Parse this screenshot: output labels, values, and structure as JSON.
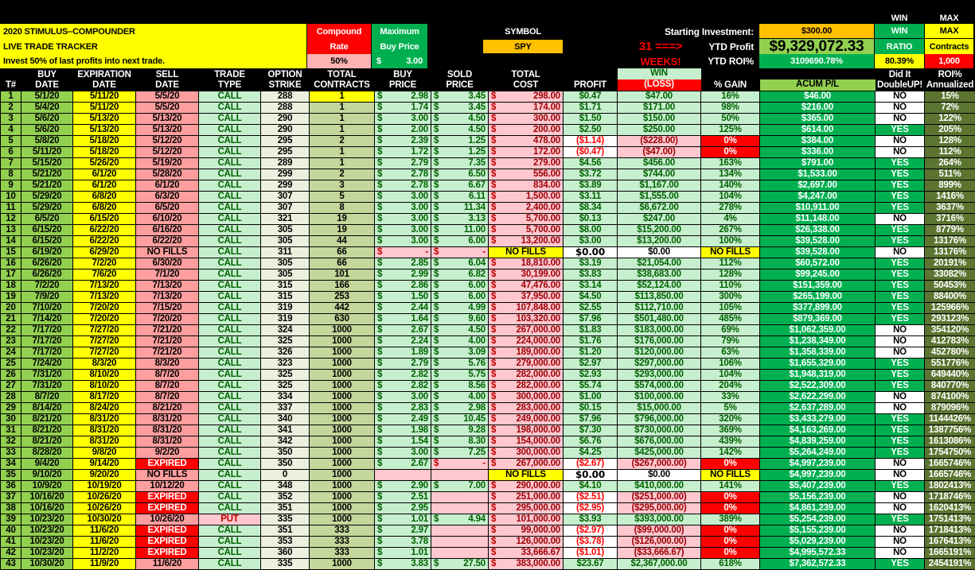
{
  "header": {
    "title1": "2020 STIMULUS–COMPOUNDER",
    "title2": "LIVE TRADE TRACKER",
    "note": "Invest 50% of last profits into next trade.",
    "compound_label1": "Compound",
    "compound_label2": "Rate",
    "compound_value": "50%",
    "maxbuy_label1": "Maximum",
    "maxbuy_label2": "Buy Price",
    "maxbuy_currency": "$",
    "maxbuy_value": "3.00",
    "symbol_label": "SYMBOL",
    "symbol_value": "SPY",
    "weeks_count": "31 ===>",
    "weeks_label": "WEEKS!",
    "starting_label": "Starting Investment:",
    "starting_value": "$300.00",
    "ytd_profit_label": "YTD Profit",
    "ytd_profit_value": "$9,329,072.33",
    "ytd_roi_label": "YTD ROI%",
    "ytd_roi_value": "3109690.78%",
    "win_top": "WIN",
    "win_label1": "WIN",
    "win_label2": "RATIO",
    "win_value": "80.39%",
    "max_top": "MAX",
    "max_label1": "MAX",
    "max_label2": "Contracts",
    "max_value": "1,000"
  },
  "columns": [
    "T#",
    "BUY\nDATE",
    "EXPIRATION\nDATE",
    "SELL\nDATE",
    "TRADE\nTYPE",
    "OPTION\nSTRIKE",
    "TOTAL\nCONTRACTS",
    "BUY\nPRICE",
    "SOLD\nPRICE",
    "TOTAL\nCOST",
    "PROFIT",
    "WIN",
    "(LOSS)",
    "% GAIN",
    "ACUM P/L",
    "Did It\nDoubleUP!",
    "ROI%\nAnnualized"
  ],
  "currency": "$",
  "rows": [
    [
      "1",
      "5/1/20",
      "5/11/20",
      "5/5/20",
      "CALL",
      "288",
      "1",
      "2.98",
      "3.45",
      "298.00",
      "$0.47",
      "$47.00",
      "16%",
      "$46.00",
      "NO",
      "15%"
    ],
    [
      "2",
      "5/4/20",
      "5/11/20",
      "5/5/20",
      "CALL",
      "288",
      "1",
      "1.74",
      "3.45",
      "174.00",
      "$1.71",
      "$171.00",
      "98%",
      "$216.00",
      "NO",
      "72%"
    ],
    [
      "3",
      "5/6/20",
      "5/13/20",
      "5/13/20",
      "CALL",
      "290",
      "1",
      "3.00",
      "4.50",
      "300.00",
      "$1.50",
      "$150.00",
      "50%",
      "$365.00",
      "NO",
      "122%"
    ],
    [
      "4",
      "5/6/20",
      "5/13/20",
      "5/13/20",
      "CALL",
      "290",
      "1",
      "2.00",
      "4.50",
      "200.00",
      "$2.50",
      "$250.00",
      "125%",
      "$614.00",
      "YES",
      "205%"
    ],
    [
      "5",
      "5/8/20",
      "5/18/20",
      "5/12/20",
      "CALL",
      "295",
      "2",
      "2.39",
      "1.25",
      "478.00",
      "($1.14)",
      "($228.00)",
      "0%",
      "$384.00",
      "NO",
      "128%"
    ],
    [
      "6",
      "5/11/20",
      "5/18/20",
      "5/12/20",
      "CALL",
      "295",
      "1",
      "1.72",
      "1.25",
      "172.00",
      "($0.47)",
      "($47.00)",
      "0%",
      "$336.00",
      "NO",
      "112%"
    ],
    [
      "7",
      "5/15/20",
      "5/26/20",
      "5/19/20",
      "CALL",
      "289",
      "1",
      "2.79",
      "7.35",
      "279.00",
      "$4.56",
      "$456.00",
      "163%",
      "$791.00",
      "YES",
      "264%"
    ],
    [
      "8",
      "5/21/20",
      "6/1/20",
      "5/28/20",
      "CALL",
      "299",
      "2",
      "2.78",
      "6.50",
      "556.00",
      "$3.72",
      "$744.00",
      "134%",
      "$1,533.00",
      "YES",
      "511%"
    ],
    [
      "9",
      "5/21/20",
      "6/1/20",
      "6/1/20",
      "CALL",
      "299",
      "3",
      "2.78",
      "6.67",
      "834.00",
      "$3.89",
      "$1,167.00",
      "140%",
      "$2,697.00",
      "YES",
      "899%"
    ],
    [
      "10",
      "5/29/20",
      "6/8/20",
      "6/3/20",
      "CALL",
      "307",
      "5",
      "3.00",
      "6.11",
      "1,500.00",
      "$3.11",
      "$1,555.00",
      "104%",
      "$4,247.00",
      "YES",
      "1416%"
    ],
    [
      "11",
      "5/29/20",
      "6/8/20",
      "6/5/20",
      "CALL",
      "307",
      "8",
      "3.00",
      "11.34",
      "2,400.00",
      "$8.34",
      "$6,672.00",
      "278%",
      "$10,911.00",
      "YES",
      "3637%"
    ],
    [
      "12",
      "6/5/20",
      "6/15/20",
      "6/10/20",
      "CALL",
      "321",
      "19",
      "3.00",
      "3.13",
      "5,700.00",
      "$0.13",
      "$247.00",
      "4%",
      "$11,148.00",
      "NO",
      "3716%"
    ],
    [
      "13",
      "6/15/20",
      "6/22/20",
      "6/16/20",
      "CALL",
      "305",
      "19",
      "3.00",
      "11.00",
      "5,700.00",
      "$8.00",
      "$15,200.00",
      "267%",
      "$26,338.00",
      "YES",
      "8779%"
    ],
    [
      "14",
      "6/15/20",
      "6/22/20",
      "6/22/20",
      "CALL",
      "305",
      "44",
      "3.00",
      "6.00",
      "13,200.00",
      "$3.00",
      "$13,200.00",
      "100%",
      "$39,528.00",
      "YES",
      "13176%"
    ],
    [
      "15",
      "6/19/20",
      "6/29/20",
      "NO FILLS",
      "CALL",
      "311",
      "66",
      "-",
      "-",
      "NO FILLS",
      "$0.00",
      "$0.00",
      "NO FILLS",
      "$39,528.00",
      "NO",
      "13176%"
    ],
    [
      "16",
      "6/26/20",
      "7/2/20",
      "6/30/20",
      "CALL",
      "305",
      "66",
      "2.85",
      "6.04",
      "18,810.00",
      "$3.19",
      "$21,054.00",
      "112%",
      "$60,572.00",
      "YES",
      "20191%"
    ],
    [
      "17",
      "6/26/20",
      "7/6/20",
      "7/1/20",
      "CALL",
      "305",
      "101",
      "2.99",
      "6.82",
      "30,199.00",
      "$3.83",
      "$38,683.00",
      "128%",
      "$99,245.00",
      "YES",
      "33082%"
    ],
    [
      "18",
      "7/2/20",
      "7/13/20",
      "7/13/20",
      "CALL",
      "315",
      "166",
      "2.86",
      "6.00",
      "47,476.00",
      "$3.14",
      "$52,124.00",
      "110%",
      "$151,359.00",
      "YES",
      "50453%"
    ],
    [
      "19",
      "7/9/20",
      "7/13/20",
      "7/13/20",
      "CALL",
      "315",
      "253",
      "1.50",
      "6.00",
      "37,950.00",
      "$4.50",
      "$113,850.00",
      "300%",
      "$265,199.00",
      "YES",
      "88400%"
    ],
    [
      "20",
      "7/10/20",
      "7/20/20",
      "7/15/20",
      "CALL",
      "319",
      "442",
      "2.44",
      "4.99",
      "107,848.00",
      "$2.55",
      "$112,710.00",
      "105%",
      "$377,899.00",
      "YES",
      "125966%"
    ],
    [
      "21",
      "7/14/20",
      "7/20/20",
      "7/20/20",
      "CALL",
      "319",
      "630",
      "1.64",
      "9.60",
      "103,320.00",
      "$7.96",
      "$501,480.00",
      "485%",
      "$879,369.00",
      "YES",
      "293123%"
    ],
    [
      "22",
      "7/17/20",
      "7/27/20",
      "7/21/20",
      "CALL",
      "324",
      "1000",
      "2.67",
      "4.50",
      "267,000.00",
      "$1.83",
      "$183,000.00",
      "69%",
      "$1,062,359.00",
      "NO",
      "354120%"
    ],
    [
      "23",
      "7/17/20",
      "7/27/20",
      "7/21/20",
      "CALL",
      "325",
      "1000",
      "2.24",
      "4.00",
      "224,000.00",
      "$1.76",
      "$176,000.00",
      "79%",
      "$1,238,349.00",
      "NO",
      "412783%"
    ],
    [
      "24",
      "7/17/20",
      "7/27/20",
      "7/21/20",
      "CALL",
      "326",
      "1000",
      "1.89",
      "3.09",
      "189,000.00",
      "$1.20",
      "$120,000.00",
      "63%",
      "$1,358,339.00",
      "NO",
      "452780%"
    ],
    [
      "25",
      "7/24/20",
      "8/3/20",
      "8/3/20",
      "CALL",
      "323",
      "1000",
      "2.79",
      "5.76",
      "279,000.00",
      "$2.97",
      "$297,000.00",
      "106%",
      "$1,655,329.00",
      "YES",
      "551776%"
    ],
    [
      "26",
      "7/31/20",
      "8/10/20",
      "8/7/20",
      "CALL",
      "325",
      "1000",
      "2.82",
      "5.75",
      "282,000.00",
      "$2.93",
      "$293,000.00",
      "104%",
      "$1,948,319.00",
      "YES",
      "649440%"
    ],
    [
      "27",
      "7/31/20",
      "8/10/20",
      "8/7/20",
      "CALL",
      "325",
      "1000",
      "2.82",
      "8.56",
      "282,000.00",
      "$5.74",
      "$574,000.00",
      "204%",
      "$2,522,309.00",
      "YES",
      "840770%"
    ],
    [
      "28",
      "8/7/20",
      "8/17/20",
      "8/7/20",
      "CALL",
      "334",
      "1000",
      "3.00",
      "4.00",
      "300,000.00",
      "$1.00",
      "$100,000.00",
      "33%",
      "$2,622,299.00",
      "NO",
      "874100%"
    ],
    [
      "29",
      "8/14/20",
      "8/24/20",
      "8/21/20",
      "CALL",
      "337",
      "1000",
      "2.83",
      "2.98",
      "283,000.00",
      "$0.15",
      "$15,000.00",
      "5%",
      "$2,637,289.00",
      "NO",
      "879096%"
    ],
    [
      "30",
      "8/21/20",
      "8/31/20",
      "8/31/20",
      "CALL",
      "340",
      "1000",
      "2.49",
      "10.45",
      "249,000.00",
      "$7.96",
      "$796,000.00",
      "320%",
      "$3,433,279.00",
      "YES",
      "1144426%"
    ],
    [
      "31",
      "8/21/20",
      "8/31/20",
      "8/31/20",
      "CALL",
      "341",
      "1000",
      "1.98",
      "9.28",
      "198,000.00",
      "$7.30",
      "$730,000.00",
      "369%",
      "$4,163,269.00",
      "YES",
      "1387756%"
    ],
    [
      "32",
      "8/21/20",
      "8/31/20",
      "8/31/20",
      "CALL",
      "342",
      "1000",
      "1.54",
      "8.30",
      "154,000.00",
      "$6.76",
      "$676,000.00",
      "439%",
      "$4,839,259.00",
      "YES",
      "1613086%"
    ],
    [
      "33",
      "8/28/20",
      "9/8/20",
      "9/2/20",
      "CALL",
      "350",
      "1000",
      "3.00",
      "7.25",
      "300,000.00",
      "$4.25",
      "$425,000.00",
      "142%",
      "$5,264,249.00",
      "YES",
      "1754750%"
    ],
    [
      "34",
      "9/4/20",
      "9/14/20",
      "EXPIRED",
      "CALL",
      "350",
      "1000",
      "2.67",
      "-",
      "267,000.00",
      "($2.67)",
      "($267,000.00)",
      "0%",
      "$4,997,239.00",
      "NO",
      "1665746%"
    ],
    [
      "35",
      "9/10/20",
      "9/20/20",
      "NO FILLS",
      "CALL",
      "0",
      "1000",
      "",
      "",
      "NO FILLS",
      "$0.00",
      "$0.00",
      "NO FILLS",
      "$4,997,239.00",
      "NO",
      "1665746%"
    ],
    [
      "36",
      "10/9/20",
      "10/19/20",
      "10/12/20",
      "CALL",
      "348",
      "1000",
      "2.90",
      "7.00",
      "290,000.00",
      "$4.10",
      "$410,000.00",
      "141%",
      "$5,407,239.00",
      "YES",
      "1802413%"
    ],
    [
      "37",
      "10/16/20",
      "10/26/20",
      "EXPIRED",
      "CALL",
      "352",
      "1000",
      "2.51",
      "",
      "251,000.00",
      "($2.51)",
      "($251,000.00)",
      "0%",
      "$5,156,239.00",
      "NO",
      "1718746%"
    ],
    [
      "38",
      "10/16/20",
      "10/26/20",
      "EXPIRED",
      "CALL",
      "351",
      "1000",
      "2.95",
      "",
      "295,000.00",
      "($2.95)",
      "($295,000.00)",
      "0%",
      "$4,861,239.00",
      "NO",
      "1620413%"
    ],
    [
      "39",
      "10/23/20",
      "10/30/20",
      "10/26/20",
      "PUT",
      "335",
      "1000",
      "1.01",
      "4.94",
      "101,000.00",
      "$3.93",
      "$393,000.00",
      "389%",
      "$5,254,239.00",
      "YES",
      "1751413%"
    ],
    [
      "40",
      "10/23/20",
      "11/6/20",
      "EXPIRED",
      "CALL",
      "351",
      "333",
      "2.97",
      "",
      "99,000.00",
      "($2.97)",
      "($99,000.00)",
      "0%",
      "$5,155,239.00",
      "NO",
      "1718413%"
    ],
    [
      "41",
      "10/23/20",
      "11/6/20",
      "EXPIRED",
      "CALL",
      "353",
      "333",
      "3.78",
      "",
      "126,000.00",
      "($3.78)",
      "($126,000.00)",
      "0%",
      "$5,029,239.00",
      "NO",
      "1676413%"
    ],
    [
      "42",
      "10/23/20",
      "11/2/20",
      "EXPIRED",
      "CALL",
      "360",
      "333",
      "1.01",
      "",
      "33,666.67",
      "($1.01)",
      "($33,666.67)",
      "0%",
      "$4,995,572.33",
      "NO",
      "1665191%"
    ],
    [
      "43",
      "10/30/20",
      "11/9/20",
      "11/6/20",
      "CALL",
      "335",
      "1000",
      "3.83",
      "27.50",
      "383,000.00",
      "$23.67",
      "$2,367,000.00",
      "618%",
      "$7,362,572.33",
      "YES",
      "2454191%"
    ]
  ]
}
